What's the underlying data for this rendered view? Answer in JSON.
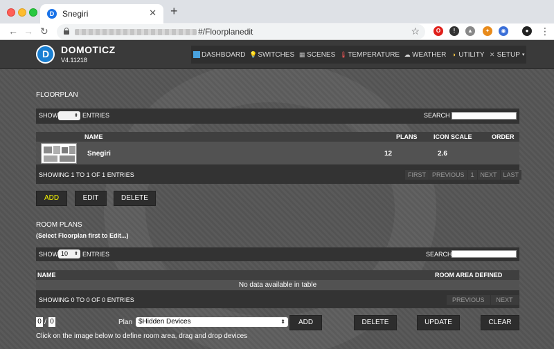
{
  "browser": {
    "tab_title": "Snegiri",
    "tab_favicon": "D",
    "url_path": "#/Floorplanedit",
    "new_tab": "+",
    "tab_close": "✕"
  },
  "app": {
    "brand": "DOMOTICZ",
    "version": "V4.11218",
    "menu": [
      {
        "label": "DASHBOARD",
        "icon": "dashboard-icon"
      },
      {
        "label": "SWITCHES",
        "icon": "bulb-icon"
      },
      {
        "label": "SCENES",
        "icon": "scenes-icon"
      },
      {
        "label": "TEMPERATURE",
        "icon": "thermometer-icon"
      },
      {
        "label": "WEATHER",
        "icon": "cloud-icon"
      },
      {
        "label": "UTILITY",
        "icon": "utility-icon"
      },
      {
        "label": "SETUP",
        "icon": "tools-icon"
      }
    ]
  },
  "floorplan": {
    "heading": "FLOORPLAN",
    "show": "SHOW",
    "entries": "ENTRIES",
    "search": "SEARCH :",
    "columns": {
      "name": "NAME",
      "plans": "PLANS",
      "icon_scale": "ICON SCALE",
      "order": "ORDER"
    },
    "rows": [
      {
        "name": "Snegiri",
        "plans": "12",
        "icon_scale": "2.6",
        "order": ""
      }
    ],
    "info": "SHOWING 1 TO 1 OF 1 ENTRIES",
    "pager": [
      "FIRST",
      "PREVIOUS",
      "1",
      "NEXT",
      "LAST"
    ],
    "buttons": {
      "add": "ADD",
      "edit": "EDIT",
      "delete": "DELETE"
    }
  },
  "room_plans": {
    "heading": "ROOM PLANS",
    "hint": "(Select Floorplan first to Edit...)",
    "show": "SHOW",
    "show_count": "10",
    "entries": "ENTRIES",
    "search": "SEARCH:",
    "columns": {
      "name": "NAME",
      "room_area": "ROOM AREA DEFINED"
    },
    "empty": "No data available in table",
    "info": "SHOWING 0 TO 0 OF 0 ENTRIES",
    "pager": [
      "PREVIOUS",
      "NEXT"
    ]
  },
  "plan_editor": {
    "x": "0",
    "sep": "/",
    "y": "0",
    "plan_label": "Plan",
    "plan_value": "$Hidden Devices",
    "add": "ADD",
    "delete": "DELETE",
    "update": "UPDATE",
    "clear": "CLEAR",
    "instruction": "Click on the image below to define room area, drag and drop devices"
  }
}
